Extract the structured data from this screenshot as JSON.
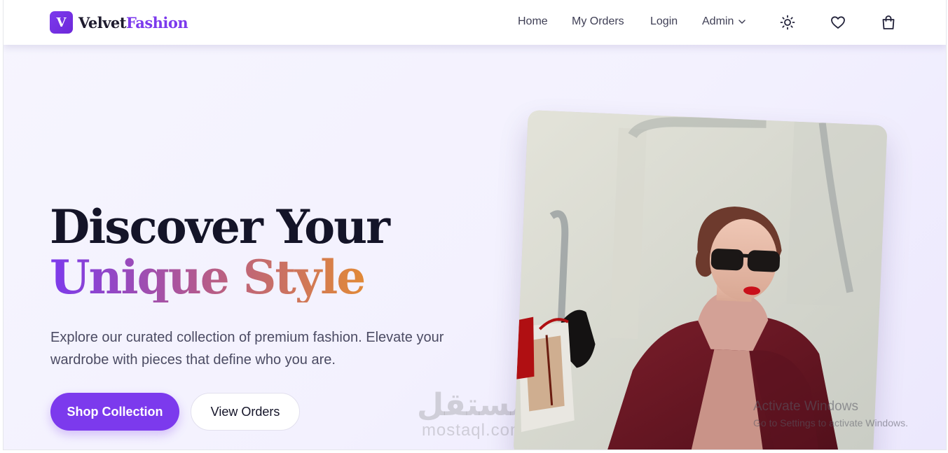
{
  "brand": {
    "mark": "V",
    "name_part1": "Velvet",
    "name_part2": "Fashion"
  },
  "nav": {
    "links": [
      "Home",
      "My Orders",
      "Login",
      "Admin"
    ],
    "icons": [
      "theme-sun-icon",
      "wishlist-heart-icon",
      "cart-bag-icon"
    ]
  },
  "hero": {
    "title_line1": "Discover Your",
    "title_line2": "Unique Style",
    "description": "Explore our curated collection of premium fashion. Elevate your wardrobe with pieces that define who you are.",
    "primary_button": "Shop Collection",
    "secondary_button": "View Orders"
  },
  "watermark": {
    "arabic": "مستقل",
    "latin": "mostaql.com"
  },
  "windows_notice": {
    "title": "Activate Windows",
    "subtitle": "Go to Settings to activate Windows."
  },
  "colors": {
    "accent": "#7c3aed",
    "gradient_end": "#e8902a",
    "text_dark": "#141428"
  }
}
